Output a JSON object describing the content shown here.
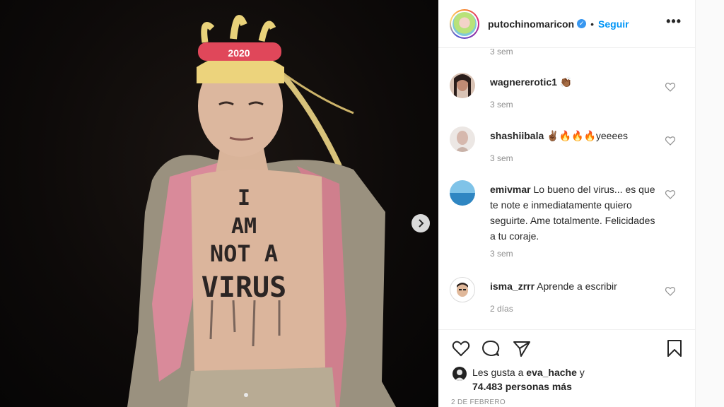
{
  "post": {
    "username": "putochinomaricon",
    "follow_label": "Seguir",
    "bullet": "•",
    "more_label": "•••",
    "verified_mark": "✓"
  },
  "photo": {
    "headband_text": "2020",
    "chest_text": [
      "I",
      "AM",
      "NOT A",
      "VIRUS"
    ]
  },
  "comments": [
    {
      "user": "",
      "text": "",
      "time": "3 sem"
    },
    {
      "user": "wagnererotic1",
      "text": "👏🏾",
      "time": "3 sem"
    },
    {
      "user": "shashiibala",
      "text": "✌🏾🔥🔥🔥yeeees",
      "time": "3 sem"
    },
    {
      "user": "emivmar",
      "text": "Lo bueno del virus... es que te note e inmediatamente quiero seguirte. Ame totalmente. Felicidades a tu coraje.",
      "time": "3 sem"
    },
    {
      "user": "isma_zrrr",
      "text": "Aprende a escribir",
      "time": "2 días"
    }
  ],
  "likes": {
    "prefix": "Les gusta a",
    "first_user": "eva_hache",
    "conj": "y",
    "count_text": "74.483 personas más"
  },
  "date": "2 DE FEBRERO",
  "colors": {
    "accent": "#0095f6",
    "muted": "#8e8e8e",
    "text": "#262626"
  },
  "icons": [
    "chevron-right-icon",
    "verified-icon",
    "more-icon",
    "heart-icon",
    "comment-icon",
    "share-icon",
    "bookmark-icon"
  ]
}
